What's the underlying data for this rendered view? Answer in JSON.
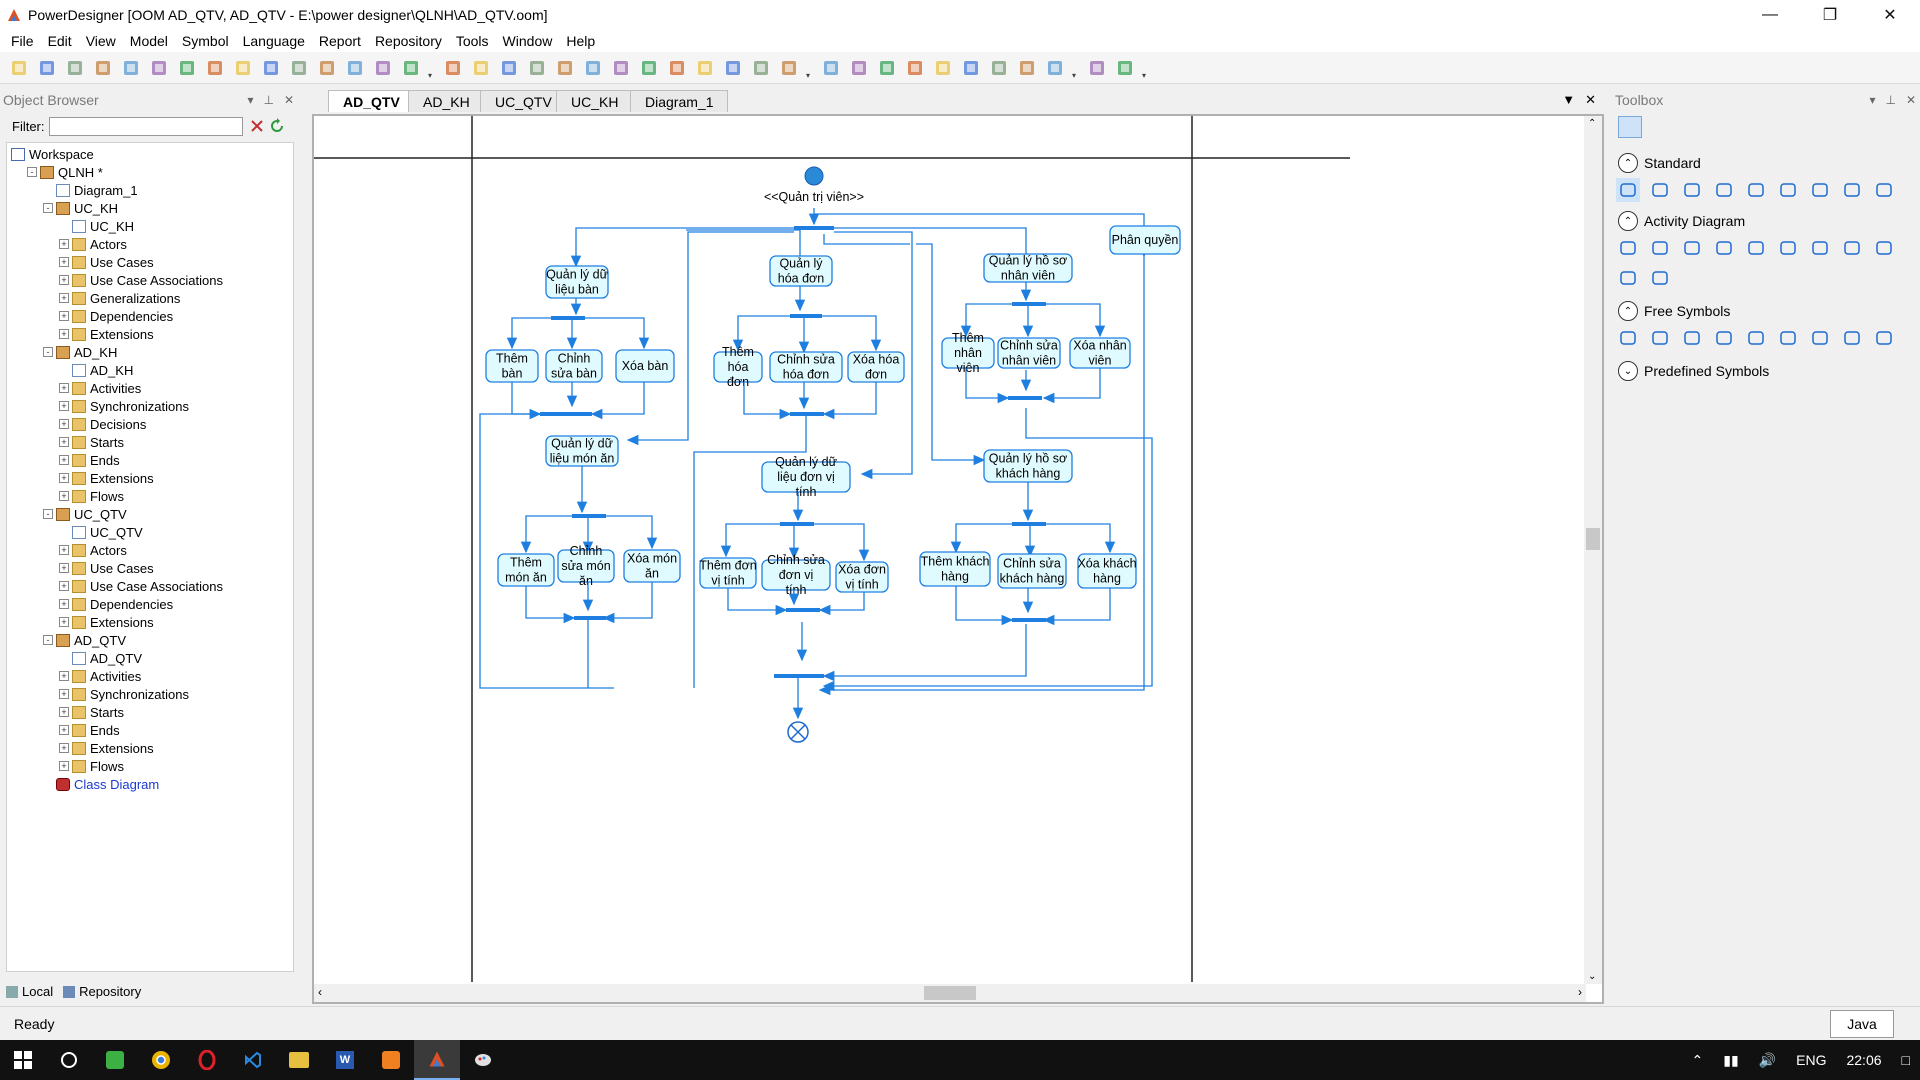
{
  "window": {
    "title": "PowerDesigner [OOM AD_QTV, AD_QTV - E:\\power designer\\QLNH\\AD_QTV.oom]"
  },
  "menu": [
    "File",
    "Edit",
    "View",
    "Model",
    "Symbol",
    "Language",
    "Report",
    "Repository",
    "Tools",
    "Window",
    "Help"
  ],
  "object_browser": {
    "title": "Object Browser",
    "filter_label": "Filter:",
    "tree": [
      {
        "label": "Workspace",
        "indent": 0,
        "icon": "workspace-icon",
        "exp": ""
      },
      {
        "label": "QLNH *",
        "indent": 1,
        "icon": "model-icon",
        "exp": "-"
      },
      {
        "label": "Diagram_1",
        "indent": 2,
        "icon": "diagram-icon",
        "exp": ""
      },
      {
        "label": "UC_KH",
        "indent": 2,
        "icon": "package-icon",
        "exp": "-"
      },
      {
        "label": "UC_KH",
        "indent": 3,
        "icon": "diagram-icon",
        "exp": ""
      },
      {
        "label": "Actors",
        "indent": 3,
        "icon": "folder-icon",
        "exp": "+"
      },
      {
        "label": "Use Cases",
        "indent": 3,
        "icon": "folder-icon",
        "exp": "+"
      },
      {
        "label": "Use Case Associations",
        "indent": 3,
        "icon": "folder-icon",
        "exp": "+"
      },
      {
        "label": "Generalizations",
        "indent": 3,
        "icon": "folder-icon",
        "exp": "+"
      },
      {
        "label": "Dependencies",
        "indent": 3,
        "icon": "folder-icon",
        "exp": "+"
      },
      {
        "label": "Extensions",
        "indent": 3,
        "icon": "folder-icon",
        "exp": "+"
      },
      {
        "label": "AD_KH",
        "indent": 2,
        "icon": "package-icon",
        "exp": "-"
      },
      {
        "label": "AD_KH",
        "indent": 3,
        "icon": "diagram-icon",
        "exp": ""
      },
      {
        "label": "Activities",
        "indent": 3,
        "icon": "folder-icon",
        "exp": "+"
      },
      {
        "label": "Synchronizations",
        "indent": 3,
        "icon": "folder-icon",
        "exp": "+"
      },
      {
        "label": "Decisions",
        "indent": 3,
        "icon": "folder-icon",
        "exp": "+"
      },
      {
        "label": "Starts",
        "indent": 3,
        "icon": "folder-icon",
        "exp": "+"
      },
      {
        "label": "Ends",
        "indent": 3,
        "icon": "folder-icon",
        "exp": "+"
      },
      {
        "label": "Extensions",
        "indent": 3,
        "icon": "folder-icon",
        "exp": "+"
      },
      {
        "label": "Flows",
        "indent": 3,
        "icon": "folder-icon",
        "exp": "+"
      },
      {
        "label": "UC_QTV",
        "indent": 2,
        "icon": "package-icon",
        "exp": "-"
      },
      {
        "label": "UC_QTV",
        "indent": 3,
        "icon": "diagram-icon",
        "exp": ""
      },
      {
        "label": "Actors",
        "indent": 3,
        "icon": "folder-icon",
        "exp": "+"
      },
      {
        "label": "Use Cases",
        "indent": 3,
        "icon": "folder-icon",
        "exp": "+"
      },
      {
        "label": "Use Case Associations",
        "indent": 3,
        "icon": "folder-icon",
        "exp": "+"
      },
      {
        "label": "Dependencies",
        "indent": 3,
        "icon": "folder-icon",
        "exp": "+"
      },
      {
        "label": "Extensions",
        "indent": 3,
        "icon": "folder-icon",
        "exp": "+"
      },
      {
        "label": "AD_QTV",
        "indent": 2,
        "icon": "package-icon",
        "exp": "-"
      },
      {
        "label": "AD_QTV",
        "indent": 3,
        "icon": "diagram-icon",
        "exp": ""
      },
      {
        "label": "Activities",
        "indent": 3,
        "icon": "folder-icon",
        "exp": "+"
      },
      {
        "label": "Synchronizations",
        "indent": 3,
        "icon": "folder-icon",
        "exp": "+"
      },
      {
        "label": "Starts",
        "indent": 3,
        "icon": "folder-icon",
        "exp": "+"
      },
      {
        "label": "Ends",
        "indent": 3,
        "icon": "folder-icon",
        "exp": "+"
      },
      {
        "label": "Extensions",
        "indent": 3,
        "icon": "folder-icon",
        "exp": "+"
      },
      {
        "label": "Flows",
        "indent": 3,
        "icon": "folder-icon",
        "exp": "+"
      },
      {
        "label": "Class Diagram",
        "indent": 2,
        "icon": "class-diagram-icon",
        "exp": "",
        "link": true
      }
    ],
    "tabs": [
      "Local",
      "Repository"
    ]
  },
  "doc_tabs": [
    "AD_QTV",
    "AD_KH",
    "UC_QTV",
    "UC_KH",
    "Diagram_1"
  ],
  "active_tab": "AD_QTV",
  "diagram": {
    "start_label": "<<Quản trị viên>>",
    "activities": {
      "ql_ban": "Quản lý dữ liệu bàn",
      "them_ban": "Thêm bàn",
      "sua_ban": "Chỉnh sửa bàn",
      "xoa_ban": "Xóa bàn",
      "ql_mon": "Quản lý dữ liệu món ăn",
      "them_mon": "Thêm món ăn",
      "sua_mon": "Chỉnh sửa món ăn",
      "xoa_mon": "Xóa món ăn",
      "ql_hd": "Quản lý hóa đơn",
      "them_hd": "Thêm hóa đơn",
      "sua_hd": "Chỉnh sửa hóa đơn",
      "xoa_hd": "Xóa hóa đơn",
      "ql_dvt": "Quản lý dữ liệu đơn vị tính",
      "them_dvt": "Thêm đơn vị tính",
      "sua_dvt": "Chỉnh sửa đơn vị tính",
      "xoa_dvt": "Xóa đơn vị tính",
      "ql_nv": "Quản lý hồ sơ nhân viên",
      "them_nv": "Thêm nhân viên",
      "sua_nv": "Chỉnh sửa nhân viên",
      "xoa_nv": "Xóa nhân viên",
      "ql_kh": "Quản lý hồ sơ khách hàng",
      "them_kh": "Thêm khách hàng",
      "sua_kh": "Chỉnh sửa khách hàng",
      "xoa_kh": "Xóa khách hàng",
      "phan_quyen": "Phân quyền"
    },
    "colors": {
      "box_fill": "#e0fbff",
      "box_stroke": "#1e7fe0",
      "line": "#1e7fe0",
      "bar": "#1e7fe0"
    }
  },
  "toolbox": {
    "title": "Toolbox",
    "groups": [
      "Standard",
      "Activity Diagram",
      "Free Symbols",
      "Predefined Symbols"
    ]
  },
  "status": {
    "text": "Ready",
    "language": "Java"
  },
  "tray": {
    "lang": "ENG",
    "time": "22:06"
  }
}
